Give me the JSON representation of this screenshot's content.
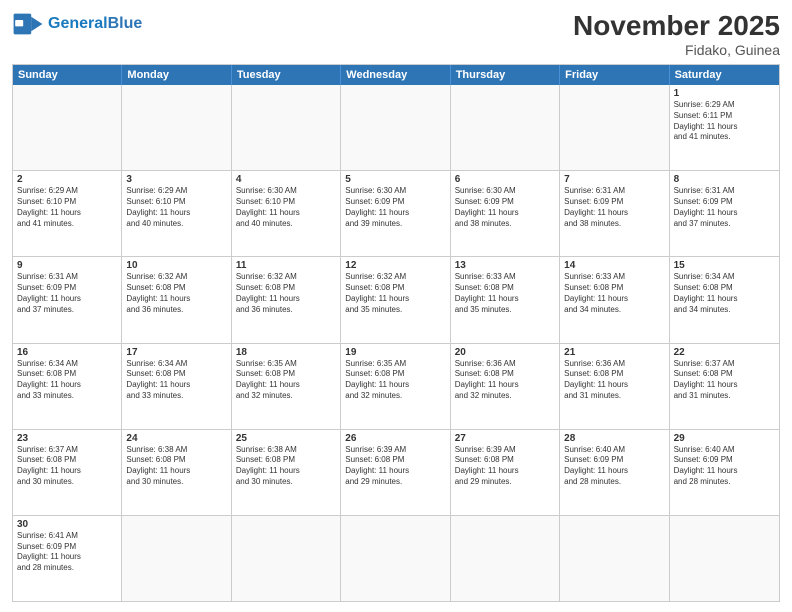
{
  "header": {
    "logo_general": "General",
    "logo_blue": "Blue",
    "month_title": "November 2025",
    "subtitle": "Fidako, Guinea"
  },
  "days": [
    "Sunday",
    "Monday",
    "Tuesday",
    "Wednesday",
    "Thursday",
    "Friday",
    "Saturday"
  ],
  "weeks": [
    [
      {
        "num": "",
        "text": "",
        "empty": true
      },
      {
        "num": "",
        "text": "",
        "empty": true
      },
      {
        "num": "",
        "text": "",
        "empty": true
      },
      {
        "num": "",
        "text": "",
        "empty": true
      },
      {
        "num": "",
        "text": "",
        "empty": true
      },
      {
        "num": "",
        "text": "",
        "empty": true
      },
      {
        "num": "1",
        "text": "Sunrise: 6:29 AM\nSunset: 6:11 PM\nDaylight: 11 hours\nand 41 minutes.",
        "empty": false
      }
    ],
    [
      {
        "num": "2",
        "text": "Sunrise: 6:29 AM\nSunset: 6:10 PM\nDaylight: 11 hours\nand 41 minutes.",
        "empty": false
      },
      {
        "num": "3",
        "text": "Sunrise: 6:29 AM\nSunset: 6:10 PM\nDaylight: 11 hours\nand 40 minutes.",
        "empty": false
      },
      {
        "num": "4",
        "text": "Sunrise: 6:30 AM\nSunset: 6:10 PM\nDaylight: 11 hours\nand 40 minutes.",
        "empty": false
      },
      {
        "num": "5",
        "text": "Sunrise: 6:30 AM\nSunset: 6:09 PM\nDaylight: 11 hours\nand 39 minutes.",
        "empty": false
      },
      {
        "num": "6",
        "text": "Sunrise: 6:30 AM\nSunset: 6:09 PM\nDaylight: 11 hours\nand 38 minutes.",
        "empty": false
      },
      {
        "num": "7",
        "text": "Sunrise: 6:31 AM\nSunset: 6:09 PM\nDaylight: 11 hours\nand 38 minutes.",
        "empty": false
      },
      {
        "num": "8",
        "text": "Sunrise: 6:31 AM\nSunset: 6:09 PM\nDaylight: 11 hours\nand 37 minutes.",
        "empty": false
      }
    ],
    [
      {
        "num": "9",
        "text": "Sunrise: 6:31 AM\nSunset: 6:09 PM\nDaylight: 11 hours\nand 37 minutes.",
        "empty": false
      },
      {
        "num": "10",
        "text": "Sunrise: 6:32 AM\nSunset: 6:08 PM\nDaylight: 11 hours\nand 36 minutes.",
        "empty": false
      },
      {
        "num": "11",
        "text": "Sunrise: 6:32 AM\nSunset: 6:08 PM\nDaylight: 11 hours\nand 36 minutes.",
        "empty": false
      },
      {
        "num": "12",
        "text": "Sunrise: 6:32 AM\nSunset: 6:08 PM\nDaylight: 11 hours\nand 35 minutes.",
        "empty": false
      },
      {
        "num": "13",
        "text": "Sunrise: 6:33 AM\nSunset: 6:08 PM\nDaylight: 11 hours\nand 35 minutes.",
        "empty": false
      },
      {
        "num": "14",
        "text": "Sunrise: 6:33 AM\nSunset: 6:08 PM\nDaylight: 11 hours\nand 34 minutes.",
        "empty": false
      },
      {
        "num": "15",
        "text": "Sunrise: 6:34 AM\nSunset: 6:08 PM\nDaylight: 11 hours\nand 34 minutes.",
        "empty": false
      }
    ],
    [
      {
        "num": "16",
        "text": "Sunrise: 6:34 AM\nSunset: 6:08 PM\nDaylight: 11 hours\nand 33 minutes.",
        "empty": false
      },
      {
        "num": "17",
        "text": "Sunrise: 6:34 AM\nSunset: 6:08 PM\nDaylight: 11 hours\nand 33 minutes.",
        "empty": false
      },
      {
        "num": "18",
        "text": "Sunrise: 6:35 AM\nSunset: 6:08 PM\nDaylight: 11 hours\nand 32 minutes.",
        "empty": false
      },
      {
        "num": "19",
        "text": "Sunrise: 6:35 AM\nSunset: 6:08 PM\nDaylight: 11 hours\nand 32 minutes.",
        "empty": false
      },
      {
        "num": "20",
        "text": "Sunrise: 6:36 AM\nSunset: 6:08 PM\nDaylight: 11 hours\nand 32 minutes.",
        "empty": false
      },
      {
        "num": "21",
        "text": "Sunrise: 6:36 AM\nSunset: 6:08 PM\nDaylight: 11 hours\nand 31 minutes.",
        "empty": false
      },
      {
        "num": "22",
        "text": "Sunrise: 6:37 AM\nSunset: 6:08 PM\nDaylight: 11 hours\nand 31 minutes.",
        "empty": false
      }
    ],
    [
      {
        "num": "23",
        "text": "Sunrise: 6:37 AM\nSunset: 6:08 PM\nDaylight: 11 hours\nand 30 minutes.",
        "empty": false
      },
      {
        "num": "24",
        "text": "Sunrise: 6:38 AM\nSunset: 6:08 PM\nDaylight: 11 hours\nand 30 minutes.",
        "empty": false
      },
      {
        "num": "25",
        "text": "Sunrise: 6:38 AM\nSunset: 6:08 PM\nDaylight: 11 hours\nand 30 minutes.",
        "empty": false
      },
      {
        "num": "26",
        "text": "Sunrise: 6:39 AM\nSunset: 6:08 PM\nDaylight: 11 hours\nand 29 minutes.",
        "empty": false
      },
      {
        "num": "27",
        "text": "Sunrise: 6:39 AM\nSunset: 6:08 PM\nDaylight: 11 hours\nand 29 minutes.",
        "empty": false
      },
      {
        "num": "28",
        "text": "Sunrise: 6:40 AM\nSunset: 6:09 PM\nDaylight: 11 hours\nand 28 minutes.",
        "empty": false
      },
      {
        "num": "29",
        "text": "Sunrise: 6:40 AM\nSunset: 6:09 PM\nDaylight: 11 hours\nand 28 minutes.",
        "empty": false
      }
    ],
    [
      {
        "num": "30",
        "text": "Sunrise: 6:41 AM\nSunset: 6:09 PM\nDaylight: 11 hours\nand 28 minutes.",
        "empty": false
      },
      {
        "num": "",
        "text": "",
        "empty": true
      },
      {
        "num": "",
        "text": "",
        "empty": true
      },
      {
        "num": "",
        "text": "",
        "empty": true
      },
      {
        "num": "",
        "text": "",
        "empty": true
      },
      {
        "num": "",
        "text": "",
        "empty": true
      },
      {
        "num": "",
        "text": "",
        "empty": true
      }
    ]
  ]
}
